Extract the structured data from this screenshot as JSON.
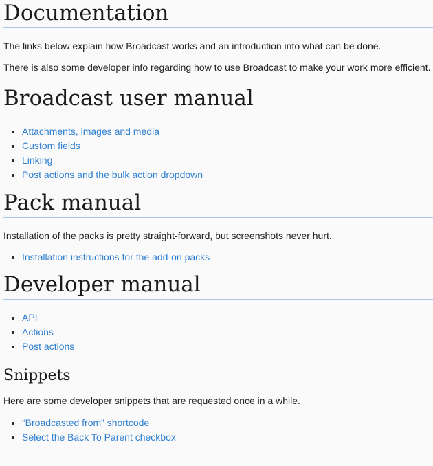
{
  "sections": {
    "documentation": {
      "title": "Documentation",
      "paragraphs": [
        "The links below explain how Broadcast works and an introduction into what can be done.",
        "There is also some developer info regarding how to use Broadcast to make your work more efficient."
      ]
    },
    "user_manual": {
      "title": "Broadcast user manual",
      "links": [
        "Attachments, images and media",
        "Custom fields",
        "Linking",
        "Post actions and the bulk action dropdown"
      ]
    },
    "pack_manual": {
      "title": "Pack manual",
      "paragraph": "Installation of the packs is pretty straight-forward, but screenshots never hurt.",
      "links": [
        "Installation instructions for the add-on packs"
      ]
    },
    "developer_manual": {
      "title": "Developer manual",
      "links": [
        "API",
        "Actions",
        "Post actions"
      ]
    },
    "snippets": {
      "title": "Snippets",
      "paragraph": "Here are some developer snippets that are requested once in a while.",
      "links": [
        "“Broadcasted from” shortcode",
        "Select the Back To Parent checkbox"
      ]
    }
  },
  "colors": {
    "link": "#2f7fd0",
    "heading_rule": "#a8c8e8",
    "background": "#fafafa"
  }
}
